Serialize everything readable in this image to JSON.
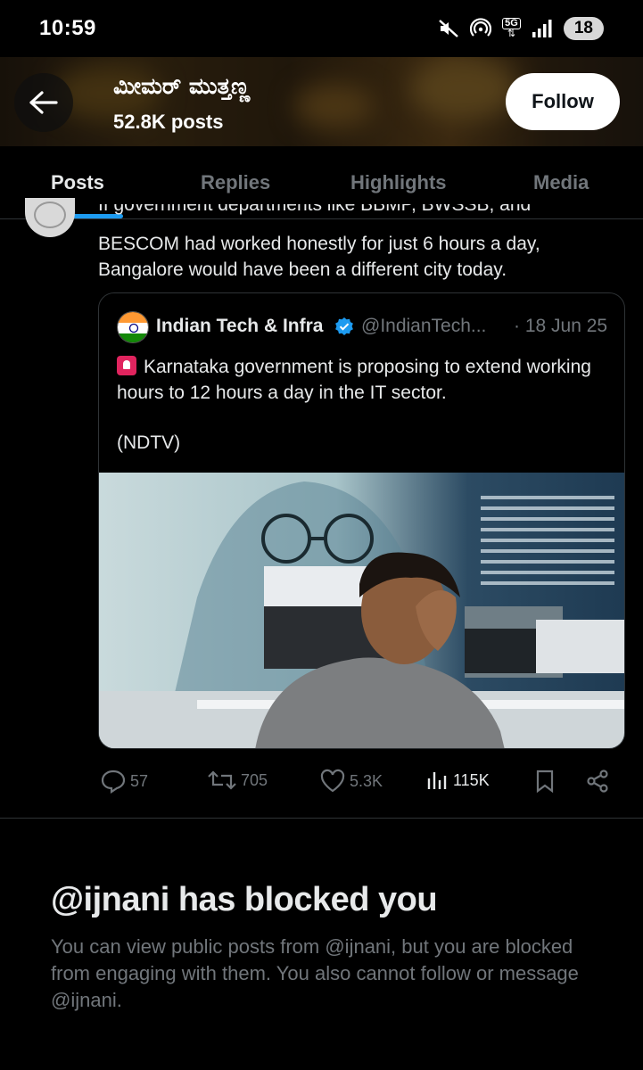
{
  "status_bar": {
    "time": "10:59",
    "network": "5G",
    "battery": "18"
  },
  "header": {
    "back_icon": "arrow-left-icon",
    "profile_name": "ಮೀಮರ್ ಮುತ್ತಣ್ಣ",
    "post_count": "52.8K posts",
    "follow_label": "Follow"
  },
  "tabs": [
    {
      "label": "Posts",
      "active": true
    },
    {
      "label": "Replies",
      "active": false
    },
    {
      "label": "Highlights",
      "active": false
    },
    {
      "label": "Media",
      "active": false
    }
  ],
  "post": {
    "text_partial_line": "If government departments like BBMP, BWSSB, and",
    "text": "BESCOM had worked honestly for just 6 hours a day, Bangalore would have been a different city today.",
    "quoted": {
      "name": "Indian Tech & Infra",
      "handle": "@IndianTech...",
      "date": "· 18 Jun 25",
      "text": "Karnataka government is proposing to extend working hours to 12 hours a day in the IT sector.",
      "source": "(NDTV)"
    },
    "actions": {
      "replies": "57",
      "reposts": "705",
      "likes": "5.3K",
      "views": "115K"
    }
  },
  "blocked": {
    "title": "@ijnani has blocked you",
    "body": "You can view public posts from @ijnani, but you are blocked from engaging with them. You also cannot follow or message @ijnani."
  },
  "colors": {
    "accent": "#1d9bf0",
    "text_primary": "#e7e9ea",
    "text_secondary": "#71767b",
    "border": "#2f3336"
  }
}
